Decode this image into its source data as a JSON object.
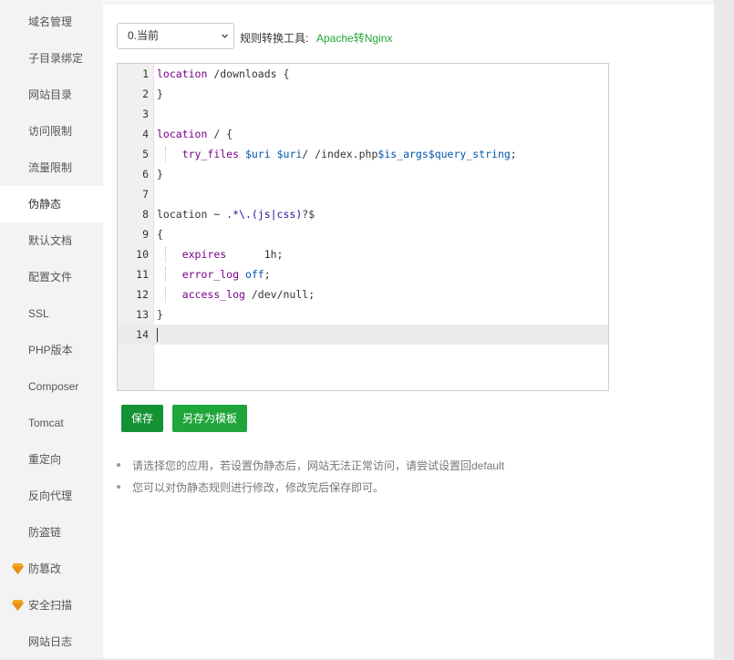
{
  "sidebar": {
    "items": [
      {
        "label": "域名管理"
      },
      {
        "label": "子目录绑定"
      },
      {
        "label": "网站目录"
      },
      {
        "label": "访问限制"
      },
      {
        "label": "流量限制"
      },
      {
        "label": "伪静态",
        "active": true
      },
      {
        "label": "默认文档"
      },
      {
        "label": "配置文件"
      },
      {
        "label": "SSL"
      },
      {
        "label": "PHP版本"
      },
      {
        "label": "Composer"
      },
      {
        "label": "Tomcat"
      },
      {
        "label": "重定向"
      },
      {
        "label": "反向代理"
      },
      {
        "label": "防盗链"
      },
      {
        "label": "防篡改",
        "icon": "diamond-icon"
      },
      {
        "label": "安全扫描",
        "icon": "diamond-icon"
      },
      {
        "label": "网站日志"
      }
    ]
  },
  "toolbar": {
    "template_select_value": "0.当前",
    "converter_label": "规则转换工具:",
    "converter_link": "Apache转Nginx"
  },
  "editor": {
    "line_numbers": [
      "1",
      "2",
      "3",
      "4",
      "5",
      "6",
      "7",
      "8",
      "9",
      "10",
      "11",
      "12",
      "13",
      "14"
    ],
    "lines": [
      "location /downloads {",
      "}",
      "",
      "location / {",
      "    try_files $uri $uri/ /index.php$is_args$query_string;",
      "}",
      "",
      "location ~ .*\\.(js|css)?$",
      "{",
      "    expires      1h;",
      "    error_log off;",
      "    access_log /dev/null;",
      "}",
      ""
    ],
    "current_line": 14
  },
  "buttons": {
    "save": "保存",
    "save_as_template": "另存为模板"
  },
  "tips": [
    "请选择您的应用，若设置伪静态后，网站无法正常访问，请尝试设置回default",
    "您可以对伪静态规则进行修改，修改完后保存即可。"
  ],
  "colors": {
    "accent": "#20a53a",
    "save_button": "#139233",
    "gem": "#f5a623",
    "keyword": "#770088",
    "variable": "#0055aa"
  }
}
